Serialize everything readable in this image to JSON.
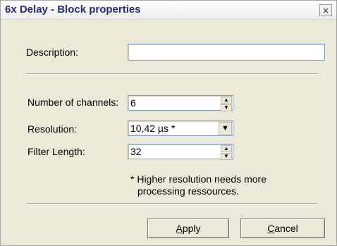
{
  "window": {
    "title": "6x Delay - Block properties",
    "close_glyph": "×"
  },
  "form": {
    "description": {
      "label": "Description:",
      "value": ""
    },
    "channels": {
      "label": "Number of channels:",
      "value": "6"
    },
    "resolution": {
      "label": "Resolution:",
      "value": "10,42 µs *"
    },
    "filter_length": {
      "label": "Filter Length:",
      "value": "32"
    }
  },
  "note": {
    "line1": "* Higher resolution needs more",
    "line2": "processing ressources."
  },
  "buttons": {
    "apply": {
      "accel": "A",
      "rest": "pply"
    },
    "cancel": {
      "accel": "C",
      "rest": "ancel"
    }
  },
  "icons": {
    "spin_up": "▲",
    "spin_down": "▼",
    "dropdown": "▼"
  }
}
